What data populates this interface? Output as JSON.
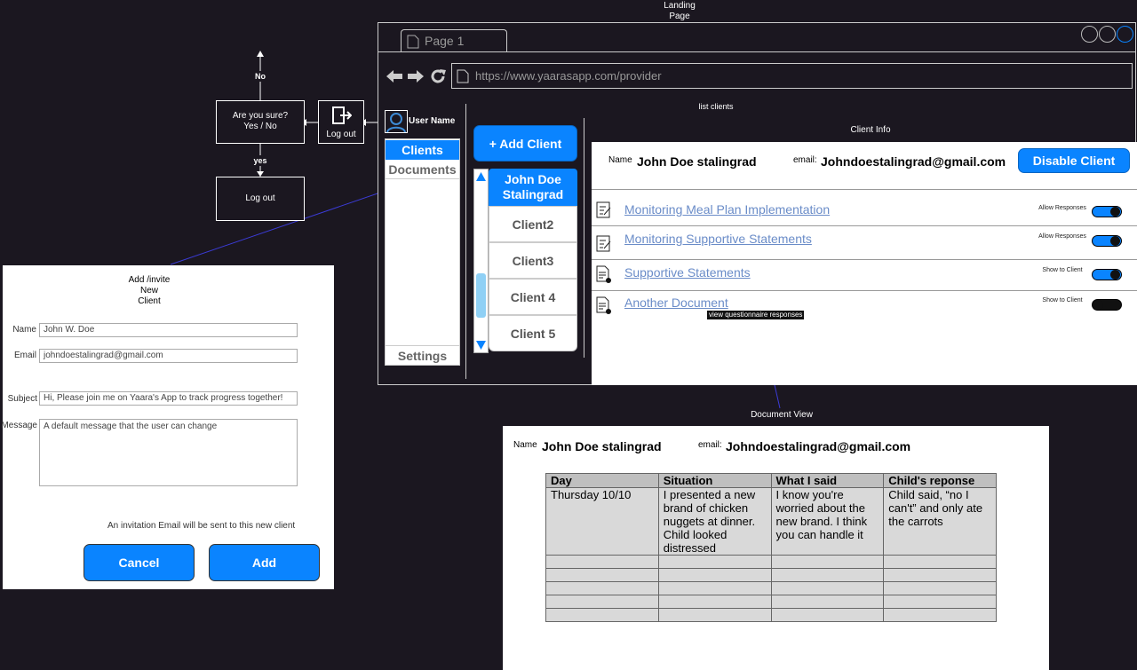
{
  "landing_title": "Landing\nPage",
  "browser": {
    "tab_label": "Page 1",
    "url": "https://www.yaarasapp.com/provider"
  },
  "header_caption": "list clients",
  "user_name": "User Name",
  "nav": {
    "clients": "Clients",
    "documents": "Documents",
    "settings": "Settings"
  },
  "add_client_button": "+ Add Client",
  "clients": [
    "John Doe Stalingrad",
    "Client2",
    "Client3",
    "Client 4",
    "Client 5"
  ],
  "client_info": {
    "caption": "Client Info",
    "name_label": "Name",
    "name": "John Doe stalingrad",
    "email_label": "email:",
    "email": "Johndoestalingrad@gmail.com",
    "disable_button": "Disable Client",
    "documents": [
      {
        "title": "Monitoring Meal Plan Implementation",
        "toggle_label": "Allow Responses",
        "toggle_on": true
      },
      {
        "title": "Monitoring Supportive Statements",
        "toggle_label": "Allow Responses",
        "toggle_on": true
      },
      {
        "title": "Supportive Statements",
        "toggle_label": "Show to Client",
        "toggle_on": true
      },
      {
        "title": "Another Document",
        "toggle_label": "Show to Client",
        "toggle_on": false
      }
    ],
    "tooltip": "view questionnaire responses"
  },
  "flow": {
    "no": "No",
    "confirm": "Are you sure?\nYes / No",
    "logout_icon_label": "Log out",
    "yes": "yes",
    "logout": "Log out"
  },
  "add_dialog": {
    "title": "Add /invite\nNew\nClient",
    "name_label": "Name",
    "name_value": "John W. Doe",
    "email_label": "Email",
    "email_value": "johndoestalingrad@gmail.com",
    "subject_label": "Subject",
    "subject_value": "Hi, Please join me on Yaara's App to track progress together!",
    "message_label": "Message",
    "message_value": "A default message that the user can change",
    "note": "An invitation Email will be sent to this new client",
    "cancel": "Cancel",
    "add": "Add"
  },
  "document_view": {
    "caption": "Document View",
    "name_label": "Name",
    "name": "John Doe stalingrad",
    "email_label": "email:",
    "email": "Johndoestalingrad@gmail.com",
    "columns": [
      "Day",
      "Situation",
      "What I said",
      "Child's reponse"
    ],
    "rows": [
      [
        "Thursday 10/10",
        "I presented a new brand of chicken nuggets at dinner. Child looked distressed",
        "I know you're worried about the new brand. I think you can handle it",
        "Child said, “no I can't” and only ate the carrots"
      ]
    ]
  },
  "colors": {
    "accent": "#0a84ff",
    "background": "#1b1720",
    "link": "#6a8cc8"
  }
}
